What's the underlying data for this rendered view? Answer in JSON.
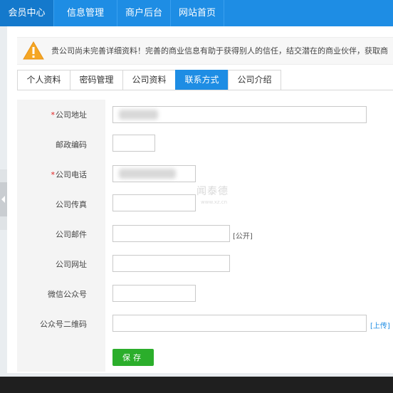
{
  "topnav": {
    "tabs": [
      {
        "label": "会员中心",
        "active": true
      },
      {
        "label": "信息管理",
        "active": false
      },
      {
        "label": "商户后台",
        "active": false
      },
      {
        "label": "网站首页",
        "active": false
      }
    ]
  },
  "notice": {
    "icon": "warning-icon",
    "text": "贵公司尚未完善详细资料！完善的商业信息有助于获得别人的信任，结交潜在的商业伙伴，获取商"
  },
  "subtabs": [
    {
      "label": "个人资料",
      "active": false
    },
    {
      "label": "密码管理",
      "active": false
    },
    {
      "label": "公司资料",
      "active": false
    },
    {
      "label": "联系方式",
      "active": true
    },
    {
      "label": "公司介绍",
      "active": false
    }
  ],
  "form": {
    "address_label": "公司地址",
    "postcode_label": "邮政编码",
    "phone_label": "公司电话",
    "fax_label": "公司传真",
    "email_label": "公司邮件",
    "email_suffix": "[公开]",
    "website_label": "公司网址",
    "wechat_label": "微信公众号",
    "qrcode_label": "公众号二维码",
    "qrcode_suffix": "[上传]",
    "save_label": "保存"
  },
  "watermark": {
    "title": "闻泰德",
    "sub": "www.xz.cn"
  },
  "colors": {
    "primary": "#1e8de4",
    "save": "#2bae2b",
    "required": "#e02020"
  }
}
